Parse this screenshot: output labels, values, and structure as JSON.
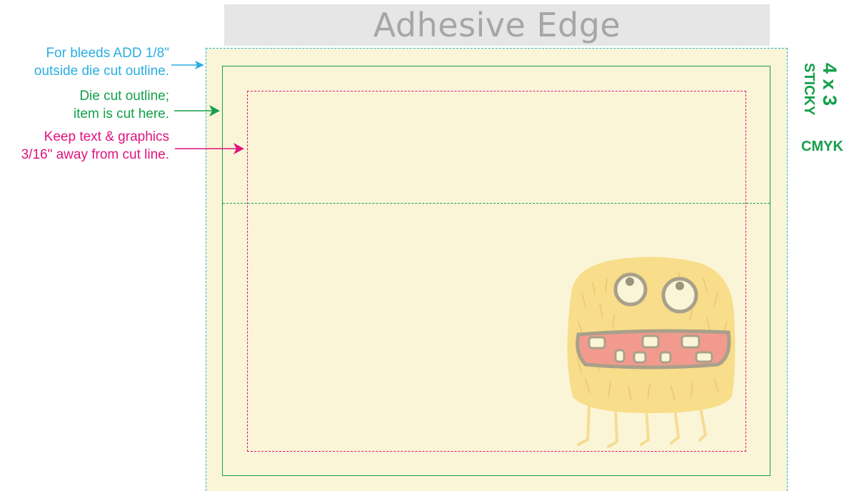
{
  "header": {
    "title": "Adhesive Edge"
  },
  "notes": {
    "bleed": {
      "line1": "For bleeds ADD 1/8\"",
      "line2": "outside die cut outline."
    },
    "die_cut": {
      "line1": "Die cut outline;",
      "line2": "item is cut here."
    },
    "safe": {
      "line1": "Keep text & graphics",
      "line2": "3/16\" away from cut line."
    }
  },
  "spec": {
    "size": "4 x 3",
    "type": "STICKY",
    "color_mode": "CMYK"
  },
  "colors": {
    "bleed": "#2bb3d9",
    "die_cut": "#14a04a",
    "safe": "#e0137f",
    "paper": "#fbf5d8",
    "header": "#e6e6e6"
  },
  "illustration": {
    "icon": "fuzzy-monster-icon"
  }
}
